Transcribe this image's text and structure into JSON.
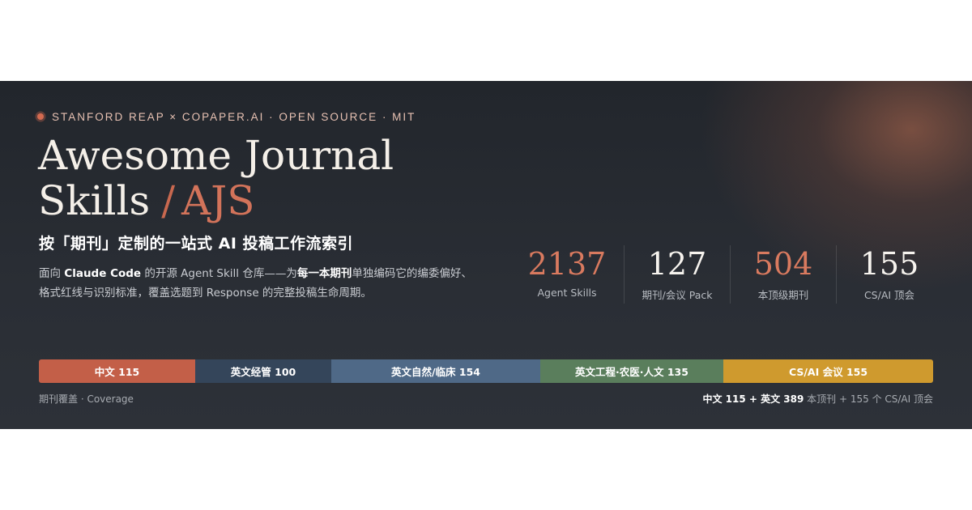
{
  "header": {
    "tagline": "STANFORD REAP × COPAPER.AI · OPEN SOURCE · MIT"
  },
  "title": {
    "line1": "Awesome Journal",
    "line2": "Skills",
    "slash": "/",
    "abbr": "AJS"
  },
  "subtitle": "按「期刊」定制的一站式 AI 投稿工作流索引",
  "description": {
    "part1": "面向 ",
    "bold1": "Claude Code",
    "part2": " 的开源 Agent Skill 仓库——为",
    "bold2": "每一本期刊",
    "part3": "单独编码它的编委偏好、格式红线与识别标准，覆盖选题到 Response 的完整投稿生命周期。"
  },
  "stats": [
    {
      "value": "2137",
      "label": "Agent Skills",
      "accent": true
    },
    {
      "value": "127",
      "label": "期刊/会议 Pack",
      "accent": false
    },
    {
      "value": "504",
      "label": "本顶级期刊",
      "accent": true
    },
    {
      "value": "155",
      "label": "CS/AI 顶会",
      "accent": false
    }
  ],
  "coverage": {
    "segments": [
      {
        "label": "中文 115",
        "value": 115,
        "color": "#c35f48"
      },
      {
        "label": "英文经管 100",
        "value": 100,
        "color": "#34455a"
      },
      {
        "label": "英文自然/临床 154",
        "value": 154,
        "color": "#4f6987"
      },
      {
        "label": "英文工程·农医·人文 135",
        "value": 135,
        "color": "#5a7e5c"
      },
      {
        "label": "CS/AI 会议 155",
        "value": 155,
        "color": "#cf9a2e"
      }
    ],
    "caption_left": "期刊覆盖 · Coverage",
    "summary": {
      "bold1": "中文 115",
      "plus1": " + ",
      "bold2": "英文 389",
      "rest": " 本顶刊 + 155 个 CS/AI 顶会"
    }
  }
}
